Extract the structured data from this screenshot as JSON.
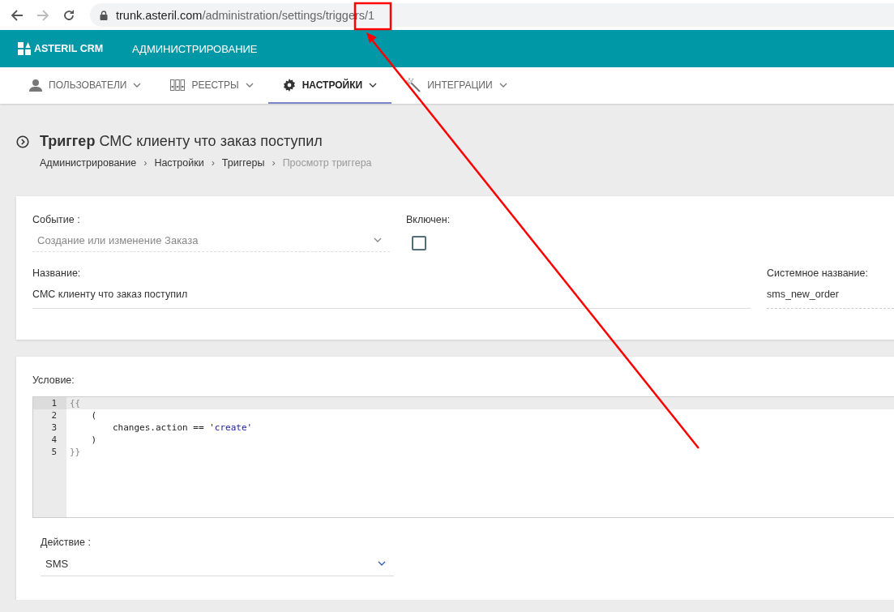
{
  "browser": {
    "back_disabled": false,
    "forward_disabled": true,
    "url_host": "trunk.asteril.com",
    "url_path": "/administration/settings/triggers/1"
  },
  "header": {
    "logo": "ASTERIL CRM",
    "section": "АДМИНИСТРИРОВАНИЕ"
  },
  "tabs": [
    {
      "label": "ПОЛЬЗОВАТЕЛИ",
      "kind": "user",
      "selected": false
    },
    {
      "label": "РЕЕСТРЫ",
      "kind": "binders",
      "selected": false
    },
    {
      "label": "НАСТРОЙКИ",
      "kind": "gear",
      "selected": true
    },
    {
      "label": "ИНТЕГРАЦИИ",
      "kind": "wand",
      "selected": false
    }
  ],
  "page": {
    "title": "**Триггер** СМС клиенту что заказ поступил",
    "breadcrumbs": [
      {
        "label": "Администрирование",
        "current": false
      },
      {
        "label": "Настройки",
        "current": false
      },
      {
        "label": "Триггеры",
        "current": false
      },
      {
        "label": "Просмотр триггера",
        "current": true
      }
    ],
    "separator": "›"
  },
  "form": {
    "event": {
      "label": "Событие :",
      "value": "Создание или изменение Заказа",
      "disabled": true
    },
    "enabled": {
      "label": "Включен:",
      "checked": false
    },
    "name": {
      "label": "Название:",
      "value": "СМС клиенту что заказ поступил"
    },
    "system_name": {
      "label": "Системное название:",
      "value": "sms_new_order",
      "disabled": true
    }
  },
  "condition": {
    "label": "Условие:",
    "lines": [
      {
        "number": "1",
        "active": true,
        "tokens": [
          {
            "kind": "bracket",
            "text": "{{"
          }
        ]
      },
      {
        "number": "2",
        "active": false,
        "tokens": [
          {
            "kind": "plain",
            "text": "    ("
          }
        ]
      },
      {
        "number": "3",
        "active": false,
        "tokens": [
          {
            "kind": "plain",
            "text": "        changes.action == "
          },
          {
            "kind": "string",
            "text": "'create'"
          }
        ]
      },
      {
        "number": "4",
        "active": false,
        "tokens": [
          {
            "kind": "plain",
            "text": "    )"
          }
        ]
      },
      {
        "number": "5",
        "active": false,
        "tokens": [
          {
            "kind": "bracket",
            "text": "}}"
          }
        ]
      }
    ]
  },
  "action": {
    "label": "Действие :",
    "value": "SMS"
  },
  "annotations": {
    "highlight_box": true,
    "arrow": true
  }
}
